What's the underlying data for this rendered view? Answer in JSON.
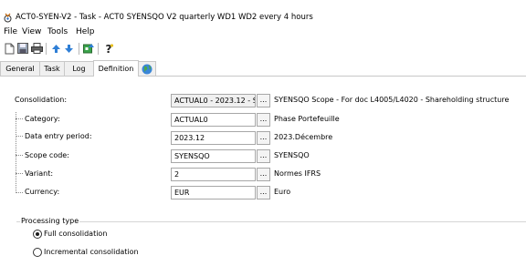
{
  "window": {
    "title": "ACT0-SYEN-V2 - Task - ACT0 SYENSQO  V2 quarterly WD1 WD2 every 4 hours"
  },
  "menu": [
    "File",
    "View",
    "Tools",
    "Help"
  ],
  "toolbar_icons": [
    "new-document-icon",
    "save-icon",
    "print-icon",
    "arrow-up-icon",
    "arrow-down-icon",
    "run-icon",
    "help-icon"
  ],
  "tabs": [
    "General",
    "Task",
    "Log",
    "Definition"
  ],
  "active_tab": "Definition",
  "form": {
    "consolidation": {
      "label": "Consolidation:",
      "value": "ACTUAL0 - 2023.12 - S",
      "description": "SYENSQO Scope - For doc L4005/L4020 - Shareholding structure"
    },
    "category": {
      "label": "Category:",
      "value": "ACTUAL0",
      "description": "Phase Portefeuille"
    },
    "data_entry_period": {
      "label": "Data entry period:",
      "value": "2023.12",
      "description": "2023.Décembre"
    },
    "scope_code": {
      "label": "Scope code:",
      "value": "SYENSQO",
      "description": "SYENSQO"
    },
    "variant": {
      "label": "Variant:",
      "value": "2",
      "description": "Normes IFRS"
    },
    "currency": {
      "label": "Currency:",
      "value": "EUR",
      "description": "Euro"
    },
    "browse_label": "..."
  },
  "processing_type": {
    "label": "Processing type",
    "options": [
      {
        "label": "Full consolidation",
        "selected": true
      },
      {
        "label": "Incremental consolidation",
        "selected": false
      }
    ]
  }
}
